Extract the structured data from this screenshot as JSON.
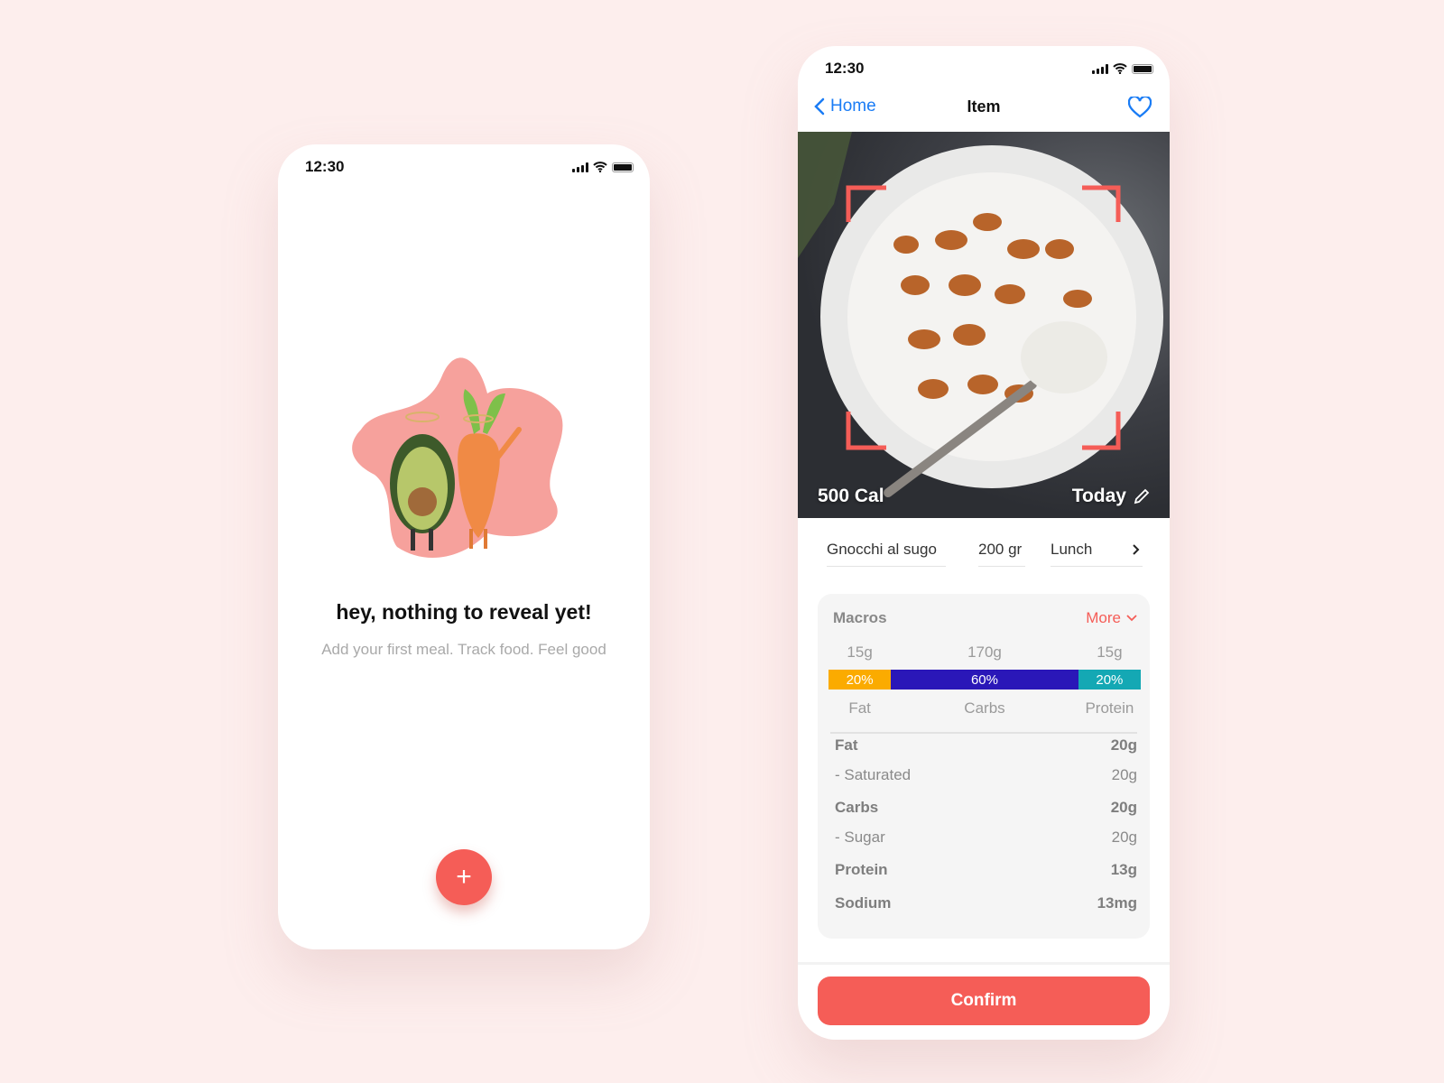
{
  "empty_screen": {
    "status_time": "12:30",
    "title": "hey, nothing to reveal yet!",
    "subtitle": "Add your first meal. Track food. Feel good",
    "fab_label": "+"
  },
  "item_screen": {
    "status_time": "12:30",
    "nav": {
      "back_label": "Home",
      "title": "Item"
    },
    "photo": {
      "calories": "500 Cal",
      "date": "Today"
    },
    "food": {
      "name": "Gnocchi al sugo",
      "quantity": "200 gr",
      "meal": "Lunch"
    },
    "macros": {
      "title": "Macros",
      "more_label": "More",
      "items": [
        {
          "label": "Fat",
          "grams": "15g",
          "percent": "20%",
          "share": 20,
          "color": "#fbab00"
        },
        {
          "label": "Carbs",
          "grams": "170g",
          "percent": "60%",
          "share": 60,
          "color": "#2a17b8"
        },
        {
          "label": "Protein",
          "grams": "15g",
          "percent": "20%",
          "share": 20,
          "color": "#14a8b4"
        }
      ]
    },
    "nutrients": [
      {
        "label": "Fat",
        "value": "20g",
        "bold": true
      },
      {
        "label": "- Saturated",
        "value": "20g",
        "bold": false
      },
      {
        "label": "Carbs",
        "value": "20g",
        "bold": true
      },
      {
        "label": "- Sugar",
        "value": "20g",
        "bold": false
      },
      {
        "label": "Protein",
        "value": "13g",
        "bold": true
      },
      {
        "label": "Sodium",
        "value": "13mg",
        "bold": true
      }
    ],
    "confirm_label": "Confirm"
  },
  "colors": {
    "accent": "#f55d57",
    "link": "#1a7cf5",
    "background": "#fdeeed"
  }
}
